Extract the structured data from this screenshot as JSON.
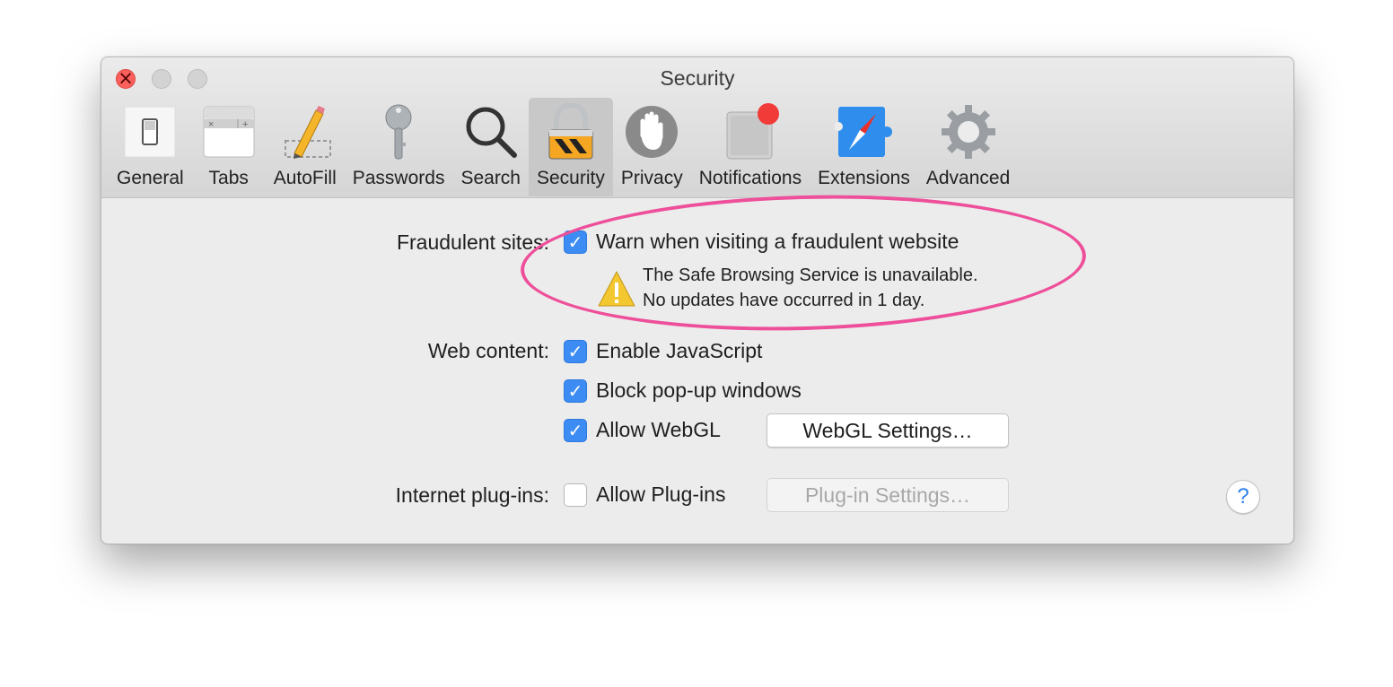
{
  "window": {
    "title": "Security"
  },
  "toolbar": {
    "items": [
      {
        "label": "General",
        "icon": "general-switch-icon"
      },
      {
        "label": "Tabs",
        "icon": "tabs-icon"
      },
      {
        "label": "AutoFill",
        "icon": "pencil-icon"
      },
      {
        "label": "Passwords",
        "icon": "key-icon"
      },
      {
        "label": "Search",
        "icon": "search-icon"
      },
      {
        "label": "Security",
        "icon": "lock-icon",
        "active": true
      },
      {
        "label": "Privacy",
        "icon": "hand-icon"
      },
      {
        "label": "Notifications",
        "icon": "notifications-icon"
      },
      {
        "label": "Extensions",
        "icon": "extensions-icon"
      },
      {
        "label": "Advanced",
        "icon": "gear-icon"
      }
    ]
  },
  "fraudulent": {
    "label": "Fraudulent sites:",
    "checkbox_label": "Warn when visiting a fraudulent website",
    "checked": true,
    "warning_line1": "The Safe Browsing Service is unavailable.",
    "warning_line2": "No updates have occurred in 1 day."
  },
  "web_content": {
    "label": "Web content:",
    "options": [
      {
        "label": "Enable JavaScript",
        "checked": true
      },
      {
        "label": "Block pop-up windows",
        "checked": true
      },
      {
        "label": "Allow WebGL",
        "checked": true
      }
    ],
    "webgl_button": "WebGL Settings…"
  },
  "plugins": {
    "label": "Internet plug-ins:",
    "checkbox_label": "Allow Plug-ins",
    "checked": false,
    "settings_button": "Plug-in Settings…"
  },
  "help": {
    "label": "?"
  },
  "colors": {
    "accent": "#3c8cf3",
    "annotation": "#ee4f9a",
    "close": "#fc605c"
  }
}
